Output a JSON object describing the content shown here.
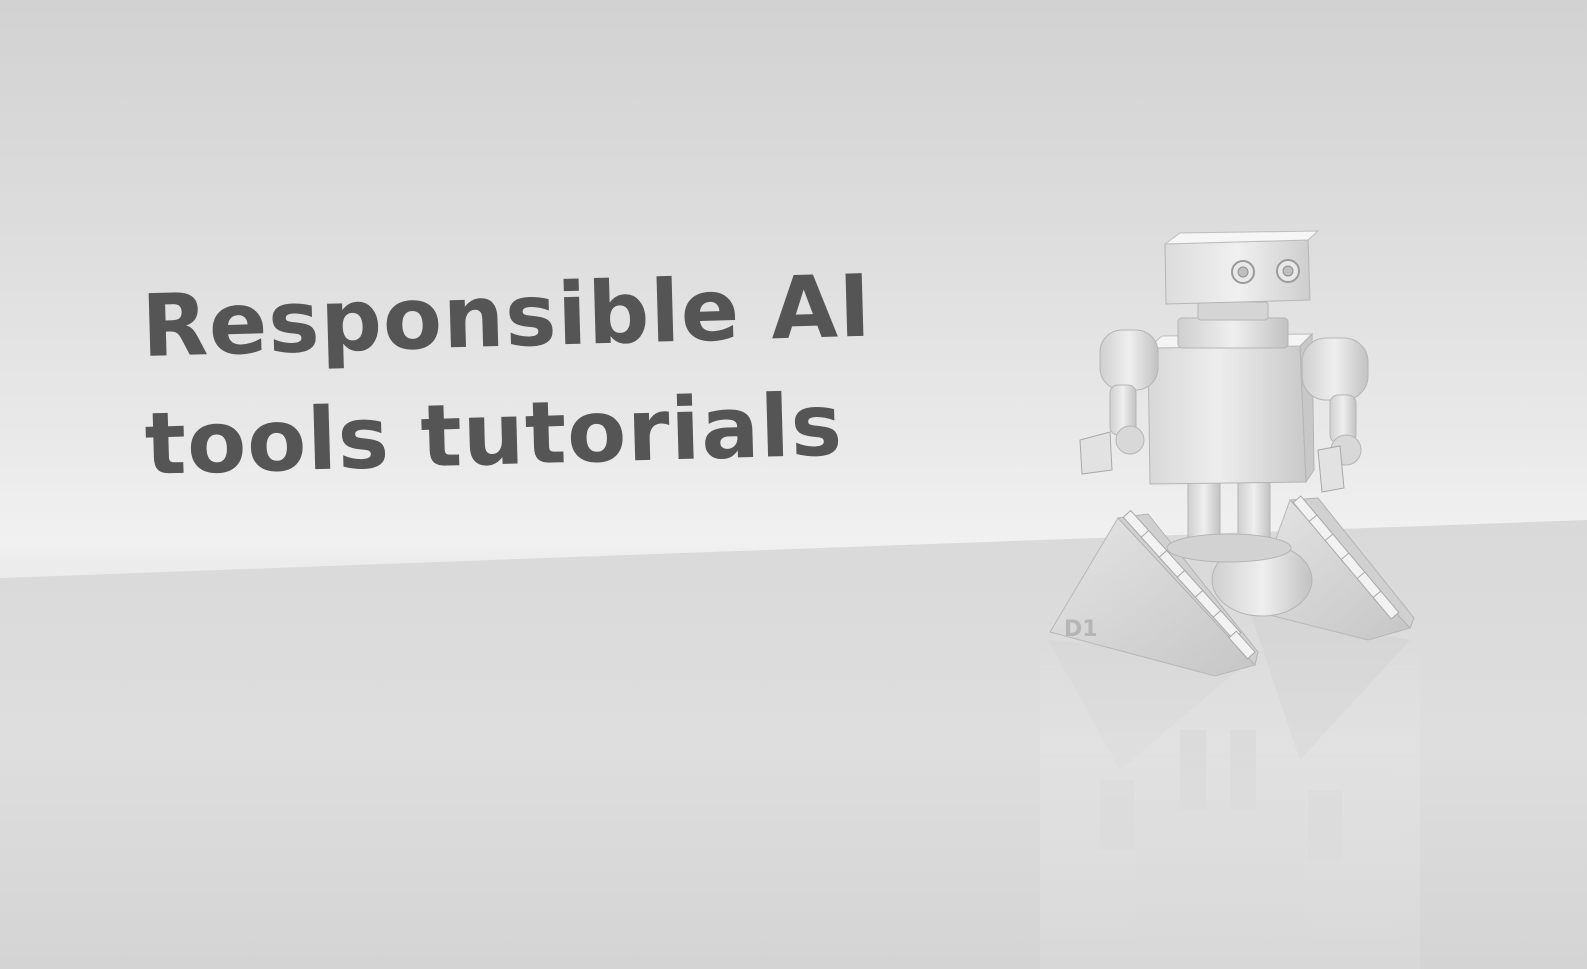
{
  "headline": {
    "line1": "Responsible AI",
    "line2": "tools tutorials"
  },
  "robot": {
    "label": "D1"
  },
  "colors": {
    "text": "#555555",
    "background_top": "#d2d2d2",
    "background_horizon": "#f1f1f1",
    "floor": "#dcdcdc"
  }
}
